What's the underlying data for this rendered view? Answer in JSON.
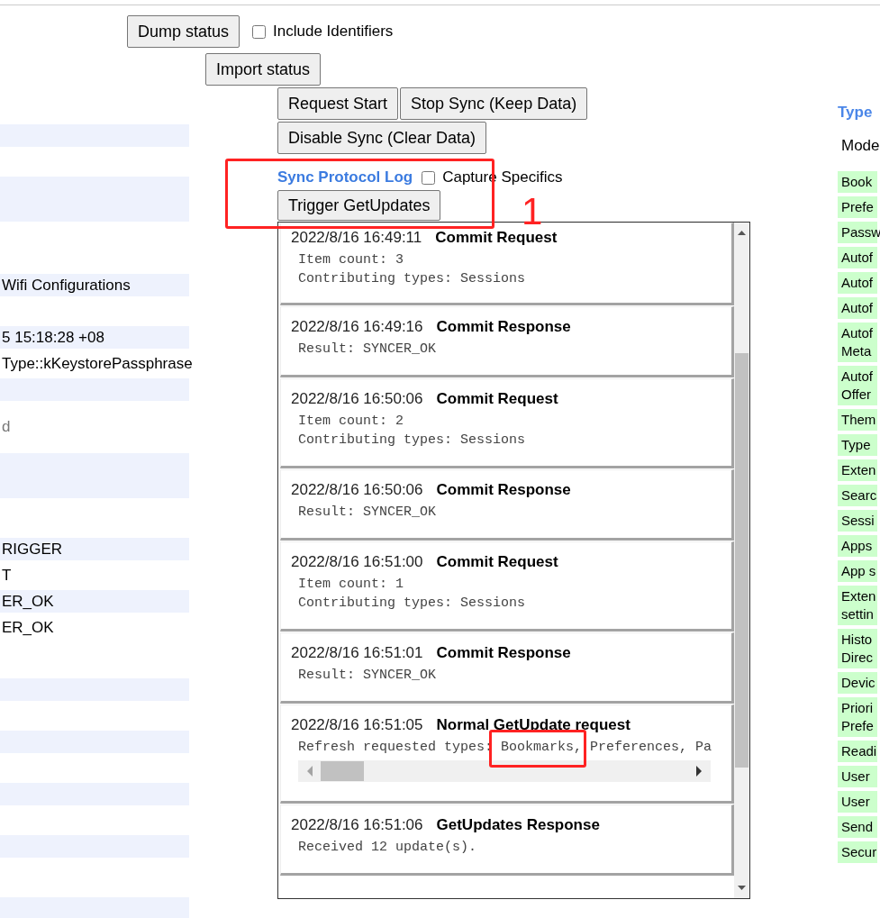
{
  "top_buttons": {
    "dump": "Dump status",
    "include_identifiers": {
      "label": "Include Identifiers",
      "checked": false
    },
    "import": "Import status"
  },
  "sync_buttons": [
    "Request Start",
    "Stop Sync (Keep Data)",
    "Disable Sync (Clear Data)"
  ],
  "protocol_log": {
    "title": "Sync Protocol Log",
    "capture_specifics": {
      "label": "Capture Specifics",
      "checked": false
    },
    "trigger": "Trigger GetUpdates",
    "entries": [
      {
        "time": "2022/8/16 16:49:11",
        "title": "Commit Request",
        "details": [
          "Item count: 3",
          "Contributing types: Sessions"
        ],
        "kind": "plain"
      },
      {
        "time": "2022/8/16 16:49:16",
        "title": "Commit Response",
        "details": [
          "Result: SYNCER_OK"
        ],
        "kind": "plain"
      },
      {
        "time": "2022/8/16 16:50:06",
        "title": "Commit Request",
        "details": [
          "Item count: 2",
          "Contributing types: Sessions"
        ],
        "kind": "plain"
      },
      {
        "time": "2022/8/16 16:50:06",
        "title": "Commit Response",
        "details": [
          "Result: SYNCER_OK"
        ],
        "kind": "plain"
      },
      {
        "time": "2022/8/16 16:51:00",
        "title": "Commit Request",
        "details": [
          "Item count: 1",
          "Contributing types: Sessions"
        ],
        "kind": "plain"
      },
      {
        "time": "2022/8/16 16:51:01",
        "title": "Commit Response",
        "details": [
          "Result: SYNCER_OK"
        ],
        "kind": "plain"
      },
      {
        "time": "2022/8/16 16:51:05",
        "title": "Normal GetUpdate request",
        "details": [
          "Refresh requested types: Bookmarks, Preferences, Pa"
        ],
        "kind": "scroll"
      },
      {
        "time": "2022/8/16 16:51:06",
        "title": "GetUpdates Response",
        "details": [
          "Received 12 update(s)."
        ],
        "kind": "plain"
      }
    ]
  },
  "left_rows": [
    {
      "kind": "stripe"
    },
    {
      "kind": "blank"
    },
    {
      "kind": "tallstripe"
    },
    {
      "kind": "tallblank"
    },
    {
      "kind": "stripe",
      "text": "Wifi Configurations"
    },
    {
      "kind": "blank"
    },
    {
      "kind": "stripe",
      "text": "5 15:18:28 +08"
    },
    {
      "kind": "blank",
      "text": "Type::kKeystorePassphrase"
    },
    {
      "kind": "stripe"
    },
    {
      "kind": "note",
      "text": "d"
    },
    {
      "kind": "tallstripe"
    },
    {
      "kind": "gap"
    },
    {
      "kind": "stripe",
      "text": "RIGGER"
    },
    {
      "kind": "blank",
      "text": "T"
    },
    {
      "kind": "stripe",
      "text": "ER_OK"
    },
    {
      "kind": "blank",
      "text": "ER_OK"
    },
    {
      "kind": "gap"
    },
    {
      "kind": "stripe"
    },
    {
      "kind": "blank"
    },
    {
      "kind": "stripe"
    },
    {
      "kind": "blank"
    },
    {
      "kind": "stripe"
    },
    {
      "kind": "blank"
    },
    {
      "kind": "stripe"
    },
    {
      "kind": "gap"
    },
    {
      "kind": "stripe"
    }
  ],
  "type_table": {
    "heading": "Type",
    "column": "Mode",
    "rows": [
      "Book",
      "Prefe",
      "Passw",
      "Autof",
      "Autof",
      "Autof",
      "Autof Meta",
      "Autof Offer",
      "Them",
      "Type",
      "Exten",
      "Searc",
      "Sessi",
      "Apps",
      "App s",
      "Exten settin",
      "Histo Direc",
      "Devic",
      "Priori Prefe",
      "Readi",
      "User",
      "User",
      "Send",
      "Secur"
    ]
  },
  "annotations": [
    {
      "kind": "box"
    },
    {
      "kind": "label",
      "text": "1"
    },
    {
      "kind": "box"
    }
  ]
}
